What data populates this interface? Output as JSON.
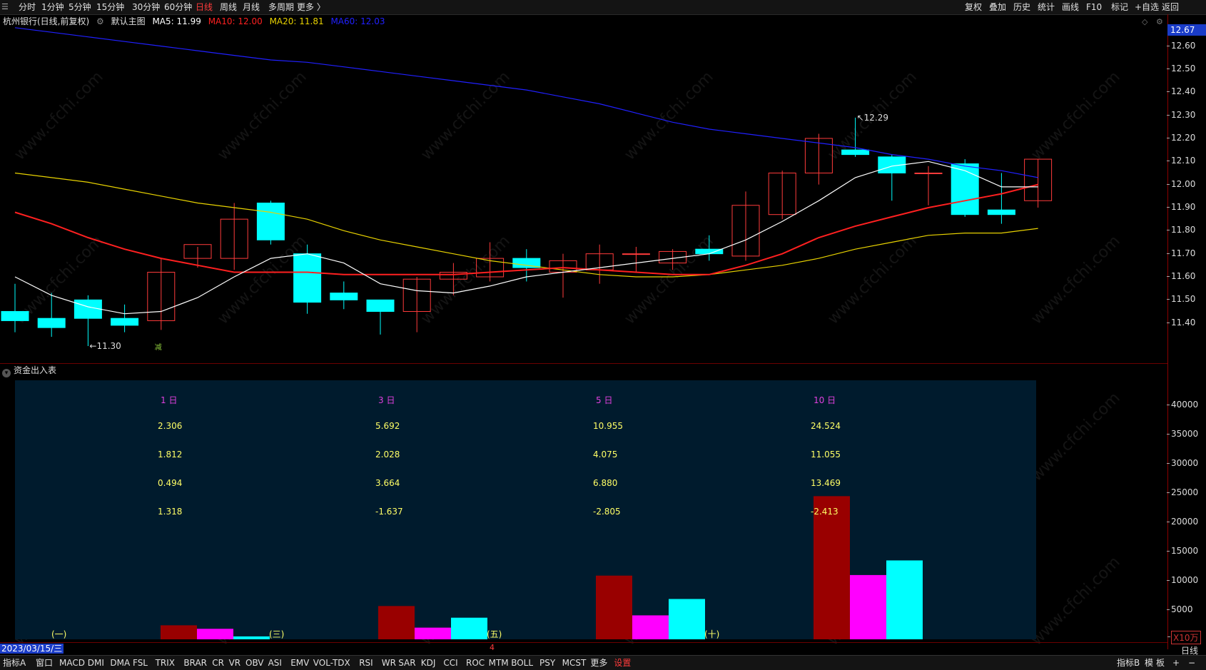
{
  "toolbar": {
    "periods": [
      "分时",
      "1分钟",
      "5分钟",
      "15分钟",
      "30分钟",
      "60分钟",
      "日线",
      "周线",
      "月线",
      "多周期",
      "更多 〉"
    ],
    "active_period": "日线",
    "right_items": [
      "复权",
      "叠加",
      "历史",
      "统计",
      "画线",
      "F10",
      "标记",
      "+自选",
      "返回"
    ]
  },
  "title": {
    "stock": "杭州银行(日线,前复权)",
    "layout": "默认主图",
    "ma5": "MA5: 11.99",
    "ma10": "MA10: 12.00",
    "ma20": "MA20: 11.81",
    "ma60": "MA60: 12.03"
  },
  "colors": {
    "up": "#ff3b3b",
    "down": "#00ffff",
    "ma5": "#ffffff",
    "ma10": "#ff2020",
    "ma20": "#e8d200",
    "ma60": "#2020ff",
    "fund_label": "#e040e0",
    "fund_value": "#ffff66",
    "bar_red": "#990000",
    "bar_magenta": "#ff00ff",
    "bar_cyan": "#00ffff"
  },
  "price_axis": {
    "current_price": "12.67",
    "ticks": [
      "12.60",
      "12.50",
      "12.40",
      "12.30",
      "12.20",
      "12.10",
      "12.00",
      "11.90",
      "11.80",
      "11.70",
      "11.60",
      "11.50",
      "11.40"
    ]
  },
  "annotations": {
    "high_label": "12.29",
    "low_label": "11.30",
    "ex_dividend_marker": "减"
  },
  "chart_data": {
    "type": "candlestick",
    "candles": [
      {
        "o": 11.45,
        "h": 11.57,
        "l": 11.36,
        "c": 11.41
      },
      {
        "o": 11.42,
        "h": 11.53,
        "l": 11.34,
        "c": 11.38
      },
      {
        "o": 11.5,
        "h": 11.52,
        "l": 11.3,
        "c": 11.42
      },
      {
        "o": 11.42,
        "h": 11.48,
        "l": 11.36,
        "c": 11.39
      },
      {
        "o": 11.41,
        "h": 11.68,
        "l": 11.37,
        "c": 11.62
      },
      {
        "o": 11.68,
        "h": 11.73,
        "l": 11.64,
        "c": 11.74
      },
      {
        "o": 11.68,
        "h": 11.92,
        "l": 11.63,
        "c": 11.85
      },
      {
        "o": 11.92,
        "h": 11.93,
        "l": 11.74,
        "c": 11.76
      },
      {
        "o": 11.7,
        "h": 11.74,
        "l": 11.44,
        "c": 11.49
      },
      {
        "o": 11.53,
        "h": 11.58,
        "l": 11.46,
        "c": 11.5
      },
      {
        "o": 11.5,
        "h": 11.5,
        "l": 11.35,
        "c": 11.45
      },
      {
        "o": 11.45,
        "h": 11.6,
        "l": 11.36,
        "c": 11.59
      },
      {
        "o": 11.59,
        "h": 11.66,
        "l": 11.52,
        "c": 11.62
      },
      {
        "o": 11.6,
        "h": 11.75,
        "l": 11.58,
        "c": 11.68
      },
      {
        "o": 11.68,
        "h": 11.72,
        "l": 11.58,
        "c": 11.64
      },
      {
        "o": 11.62,
        "h": 11.7,
        "l": 11.51,
        "c": 11.67
      },
      {
        "o": 11.63,
        "h": 11.74,
        "l": 11.57,
        "c": 11.7
      },
      {
        "o": 11.7,
        "h": 11.73,
        "l": 11.62,
        "c": 11.7
      },
      {
        "o": 11.66,
        "h": 11.72,
        "l": 11.63,
        "c": 11.71
      },
      {
        "o": 11.72,
        "h": 11.78,
        "l": 11.67,
        "c": 11.7
      },
      {
        "o": 11.69,
        "h": 11.97,
        "l": 11.67,
        "c": 11.91
      },
      {
        "o": 11.87,
        "h": 12.06,
        "l": 11.85,
        "c": 12.05
      },
      {
        "o": 12.05,
        "h": 12.22,
        "l": 12.0,
        "c": 12.2
      },
      {
        "o": 12.15,
        "h": 12.29,
        "l": 12.12,
        "c": 12.13
      },
      {
        "o": 12.12,
        "h": 12.13,
        "l": 11.93,
        "c": 12.05
      },
      {
        "o": 12.05,
        "h": 12.08,
        "l": 11.91,
        "c": 12.05
      },
      {
        "o": 12.09,
        "h": 12.11,
        "l": 11.86,
        "c": 11.87
      },
      {
        "o": 11.89,
        "h": 12.05,
        "l": 11.83,
        "c": 11.87
      },
      {
        "o": 11.93,
        "h": 12.11,
        "l": 11.9,
        "c": 12.11
      }
    ],
    "ma5": [
      11.6,
      11.52,
      11.47,
      11.44,
      11.45,
      11.51,
      11.6,
      11.68,
      11.7,
      11.66,
      11.57,
      11.54,
      11.53,
      11.56,
      11.6,
      11.62,
      11.64,
      11.66,
      11.68,
      11.7,
      11.76,
      11.84,
      11.93,
      12.03,
      12.08,
      12.1,
      12.06,
      11.99,
      11.99
    ],
    "ma10": [
      11.88,
      11.83,
      11.77,
      11.72,
      11.68,
      11.65,
      11.62,
      11.62,
      11.62,
      11.61,
      11.61,
      11.61,
      11.61,
      11.62,
      11.63,
      11.64,
      11.63,
      11.62,
      11.61,
      11.61,
      11.65,
      11.7,
      11.77,
      11.82,
      11.86,
      11.9,
      11.93,
      11.96,
      12.0
    ],
    "ma20": [
      12.05,
      12.03,
      12.01,
      11.98,
      11.95,
      11.92,
      11.9,
      11.88,
      11.85,
      11.8,
      11.76,
      11.73,
      11.7,
      11.67,
      11.65,
      11.63,
      11.61,
      11.6,
      11.6,
      11.61,
      11.63,
      11.65,
      11.68,
      11.72,
      11.75,
      11.78,
      11.79,
      11.79,
      11.81
    ],
    "ma60": [
      12.68,
      12.66,
      12.64,
      12.62,
      12.6,
      12.58,
      12.56,
      12.54,
      12.53,
      12.51,
      12.49,
      12.47,
      12.45,
      12.43,
      12.41,
      12.38,
      12.35,
      12.31,
      12.27,
      12.24,
      12.22,
      12.2,
      12.18,
      12.16,
      12.13,
      12.11,
      12.08,
      12.06,
      12.03
    ],
    "price_range": [
      11.3,
      12.67
    ]
  },
  "fund_panel": {
    "title": "资金出入表",
    "columns": [
      {
        "label": "1 日",
        "values": [
          "2.306",
          "1.812",
          "0.494",
          "1.318"
        ],
        "tag": "(一)",
        "bars": [
          2400,
          1800,
          500
        ]
      },
      {
        "label": "3 日",
        "values": [
          "5.692",
          "2.028",
          "3.664",
          "-1.637"
        ],
        "tag": "(三)",
        "bars": [
          5700,
          2000,
          3700
        ]
      },
      {
        "label": "5 日",
        "values": [
          "10.955",
          "4.075",
          "6.880",
          "-2.805"
        ],
        "tag": "(五)",
        "bars": [
          10900,
          4100,
          6900
        ]
      },
      {
        "label": "10 日",
        "values": [
          "24.524",
          "11.055",
          "13.469",
          "-2.413"
        ],
        "tag": "(十)",
        "bars": [
          24500,
          11000,
          13500
        ]
      }
    ],
    "axis_ticks": [
      "40000",
      "35000",
      "30000",
      "25000",
      "20000",
      "15000",
      "10000",
      "5000"
    ],
    "unit": "X10万",
    "axis_max": 42000
  },
  "date_label": "2023/03/15/三",
  "scroll_marker": "4",
  "period_label": "日线",
  "bottom_tabs": [
    "指标A",
    "窗口",
    "MACD",
    "DMI",
    "DMA",
    "FSL",
    "TRIX",
    "BRAR",
    "CR",
    "VR",
    "OBV",
    "ASI",
    "EMV",
    "VOL-TDX",
    "RSI",
    "WR",
    "SAR",
    "KDJ",
    "CCI",
    "ROC",
    "MTM",
    "BOLL",
    "PSY",
    "MCST",
    "更多",
    "设置"
  ],
  "bottom_right": [
    "指标B",
    "模",
    "板",
    "+",
    "−"
  ],
  "watermark": "www.cfchi.com"
}
